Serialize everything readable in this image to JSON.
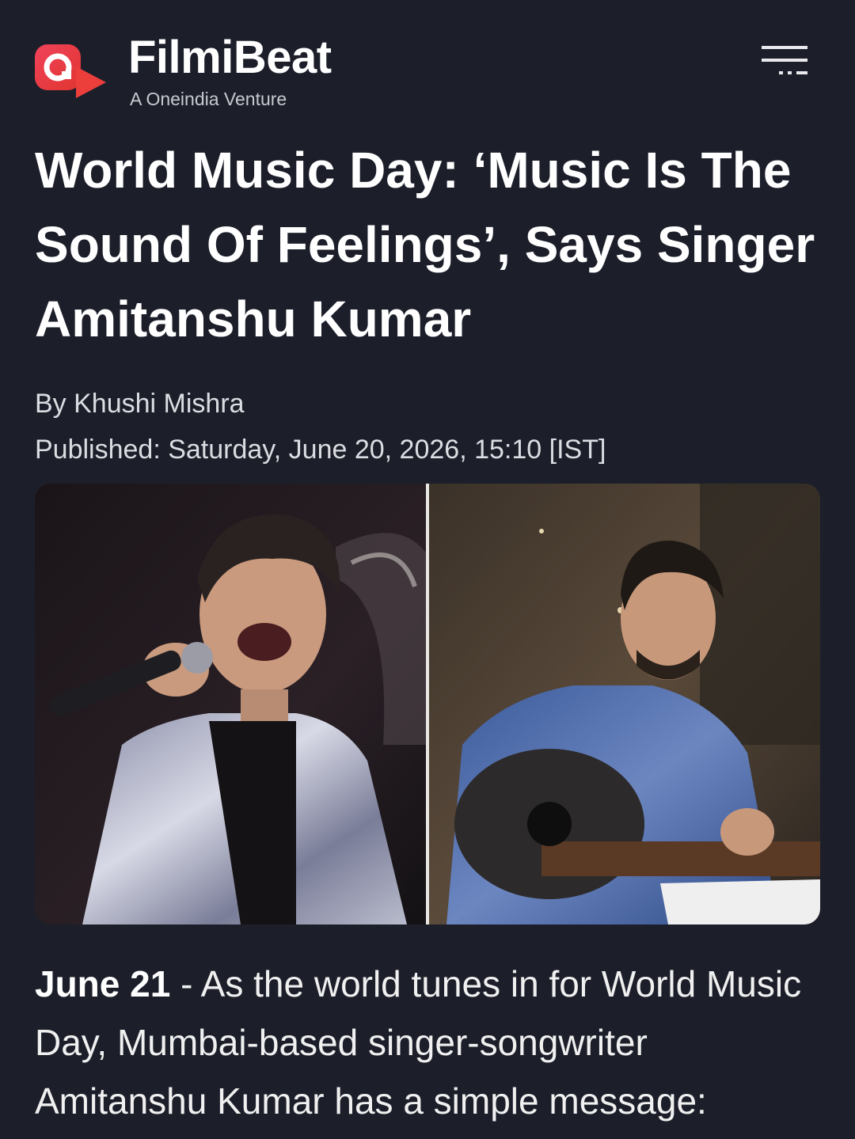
{
  "header": {
    "brand_name": "FilmiBeat",
    "tagline": "A Oneindia Venture",
    "logo_icon": "filmibeat-play-logo",
    "menu_icon": "hamburger-menu-icon",
    "brand_color": "#e8394a"
  },
  "article": {
    "headline": "World Music Day: ‘Music Is The Sound Of Feelings’, Says Singer Amitanshu Kumar",
    "byline": "By Khushi Mishra",
    "published": "Published: Saturday, June 20, 2026, 15:10 [IST]",
    "dateline": "June 21",
    "dateline_separator": " - ",
    "body": "As the world tunes in for World Music Day, Mumbai-based singer-songwriter Amitanshu Kumar has a simple message:"
  },
  "colors": {
    "background": "#1c1f2a",
    "text": "#ffffff"
  }
}
